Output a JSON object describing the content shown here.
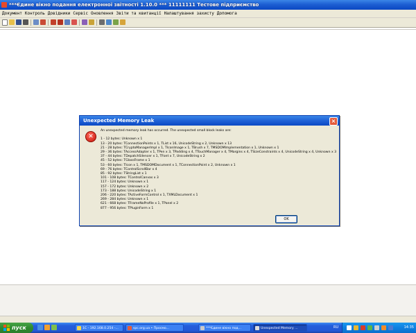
{
  "window": {
    "title": "***Єдине вікно подання електронної звітності 1.10.0 *** 11111111 Тестове підприємство"
  },
  "menu": {
    "items": [
      "Документ",
      "Контроль",
      "Довідники",
      "Сервіс",
      "Оновлення",
      "Звіти та квитанції",
      "Налаштування захисту",
      "Допомога"
    ]
  },
  "toolbar": {
    "icons": [
      "new-doc-icon",
      "open-icon",
      "save-icon",
      "print-icon",
      "preview-icon",
      "attach-icon",
      "sign-icon",
      "encrypt-icon",
      "send-icon",
      "receive-icon",
      "edit-icon",
      "key-icon",
      "certificate-icon",
      "import-icon",
      "export-icon",
      "exit-icon"
    ]
  },
  "dialog": {
    "title": "Unexpected Memory Leak",
    "close_glyph": "×",
    "intro": "An unexpected memory leak has occurred. The unexpected small block leaks are:",
    "lines": [
      "1 - 12 bytes: Unknown x 1",
      "13 - 20 bytes: TConnectionPoints x 1, TList x 16, UnicodeString x 2, Unknown x 13",
      "21 - 28 bytes: TCryptoManagerImpl x 1, TIconImage x 1, TBrush x 7, TMSDOMImplementation x 1, Unknown x 1",
      "29 - 36 bytes: TAccessAdapter x 1, TPen x 3, TPadding x 4, TTouchManager x 4, TMargins x 4, TSizeConstraints x 4, UnicodeString x 4, Unknown x 3",
      "37 - 44 bytes: TDepatchSilencer x 1, TFont x 7, UnicodeString x 2",
      "45 - 52 bytes: TGlassFrame x 1",
      "53 - 60 bytes: TIcon x 1, TMSDOMDocument x 1, TConnectionPoint x 2, Unknown x 1",
      "69 - 76 bytes: TControlScrollBar x 4",
      "85 - 92 bytes: TStringList x 1",
      "101 - 108 bytes: TControlCanvas x 3",
      "117 - 124 bytes: Unknown x 1",
      "157 - 172 bytes: Unknown x 2",
      "173 - 188 bytes: UnicodeString x 1",
      "206 - 220 bytes: TActiveFormControl x 1, TXMLDocument x 1",
      "269 - 284 bytes: Unknown x 1",
      "621 - 668 bytes: TFrameNoProfile x 1, TPanel x 2",
      "877 - 956 bytes: TPluginForm x 1"
    ],
    "ok_label": "OK"
  },
  "taskbar": {
    "start_label": "пуск",
    "tasks": [
      {
        "label": "1С - 192.168.0.254 -..."
      },
      {
        "label": "spc.org.ua • Просмо..."
      },
      {
        "label": "***Єдине вікно под..."
      },
      {
        "label": "Unexpected Memory ..."
      }
    ],
    "language": "RU",
    "clock": "14:35"
  },
  "colors": {
    "titlebar": "#1d5fd3",
    "panel": "#ece9d8",
    "taskbar": "#245edb",
    "start": "#2f8b2f",
    "error": "#c8140a"
  }
}
